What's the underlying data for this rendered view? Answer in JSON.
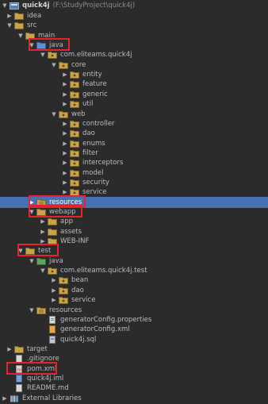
{
  "colors": {
    "background": "#2b2b2b",
    "selected_row": "#4a6fb4",
    "highlight_box": "#e4232f",
    "folder": "#c9a24b",
    "source_folder": "#5b8fd6",
    "resource_folder": "#c9a24b",
    "package": "#c9a24b"
  },
  "tree": {
    "root": {
      "name": "quick4j",
      "path": "(F:\\StudyProject\\quick4j)"
    },
    "items": [
      {
        "label": "idea",
        "icon": "folder-icon",
        "arrow": "right"
      },
      {
        "label": "src",
        "icon": "folder-icon",
        "arrow": "down"
      },
      {
        "label": "main",
        "icon": "folder-icon",
        "arrow": "down"
      },
      {
        "label": "java",
        "icon": "source-folder-icon",
        "arrow": "down"
      },
      {
        "label": "com.eliteams.quick4j",
        "icon": "package-icon",
        "arrow": "down"
      },
      {
        "label": "core",
        "icon": "package-icon",
        "arrow": "down"
      },
      {
        "label": "entity",
        "icon": "package-icon",
        "arrow": "right"
      },
      {
        "label": "feature",
        "icon": "package-icon",
        "arrow": "right"
      },
      {
        "label": "generic",
        "icon": "package-icon",
        "arrow": "right"
      },
      {
        "label": "util",
        "icon": "package-icon",
        "arrow": "right"
      },
      {
        "label": "web",
        "icon": "package-icon",
        "arrow": "down"
      },
      {
        "label": "controller",
        "icon": "package-icon",
        "arrow": "right"
      },
      {
        "label": "dao",
        "icon": "package-icon",
        "arrow": "right"
      },
      {
        "label": "enums",
        "icon": "package-icon",
        "arrow": "right"
      },
      {
        "label": "filter",
        "icon": "package-icon",
        "arrow": "right"
      },
      {
        "label": "interceptors",
        "icon": "package-icon",
        "arrow": "right"
      },
      {
        "label": "model",
        "icon": "package-icon",
        "arrow": "right"
      },
      {
        "label": "security",
        "icon": "package-icon",
        "arrow": "right"
      },
      {
        "label": "service",
        "icon": "package-icon",
        "arrow": "right"
      },
      {
        "label": "resources",
        "icon": "resources-folder-icon",
        "arrow": "right"
      },
      {
        "label": "webapp",
        "icon": "folder-icon",
        "arrow": "down"
      },
      {
        "label": "app",
        "icon": "folder-icon",
        "arrow": "right"
      },
      {
        "label": "assets",
        "icon": "folder-icon",
        "arrow": "right"
      },
      {
        "label": "WEB-INF",
        "icon": "folder-icon",
        "arrow": "right"
      },
      {
        "label": "test",
        "icon": "folder-icon",
        "arrow": "down"
      },
      {
        "label": "java",
        "icon": "test-source-folder-icon",
        "arrow": "down"
      },
      {
        "label": "com.eliteams.quick4j.test",
        "icon": "package-icon",
        "arrow": "down"
      },
      {
        "label": "bean",
        "icon": "package-icon",
        "arrow": "right"
      },
      {
        "label": "dao",
        "icon": "package-icon",
        "arrow": "right"
      },
      {
        "label": "service",
        "icon": "package-icon",
        "arrow": "right"
      },
      {
        "label": "resources",
        "icon": "resources-folder-icon",
        "arrow": "down"
      },
      {
        "label": "generatorConfig.properties",
        "icon": "properties-file-icon",
        "arrow": ""
      },
      {
        "label": "generatorConfig.xml",
        "icon": "xml-file-icon",
        "arrow": ""
      },
      {
        "label": "quick4j.sql",
        "icon": "sql-file-icon",
        "arrow": ""
      },
      {
        "label": "target",
        "icon": "folder-icon",
        "arrow": "right"
      },
      {
        "label": ".gitignore",
        "icon": "text-file-icon",
        "arrow": ""
      },
      {
        "label": "pom.xml",
        "icon": "maven-file-icon",
        "arrow": ""
      },
      {
        "label": "quick4j.iml",
        "icon": "iml-file-icon",
        "arrow": ""
      },
      {
        "label": "README.md",
        "icon": "text-file-icon",
        "arrow": ""
      },
      {
        "label": "External Libraries",
        "icon": "library-icon",
        "arrow": "right"
      }
    ]
  }
}
